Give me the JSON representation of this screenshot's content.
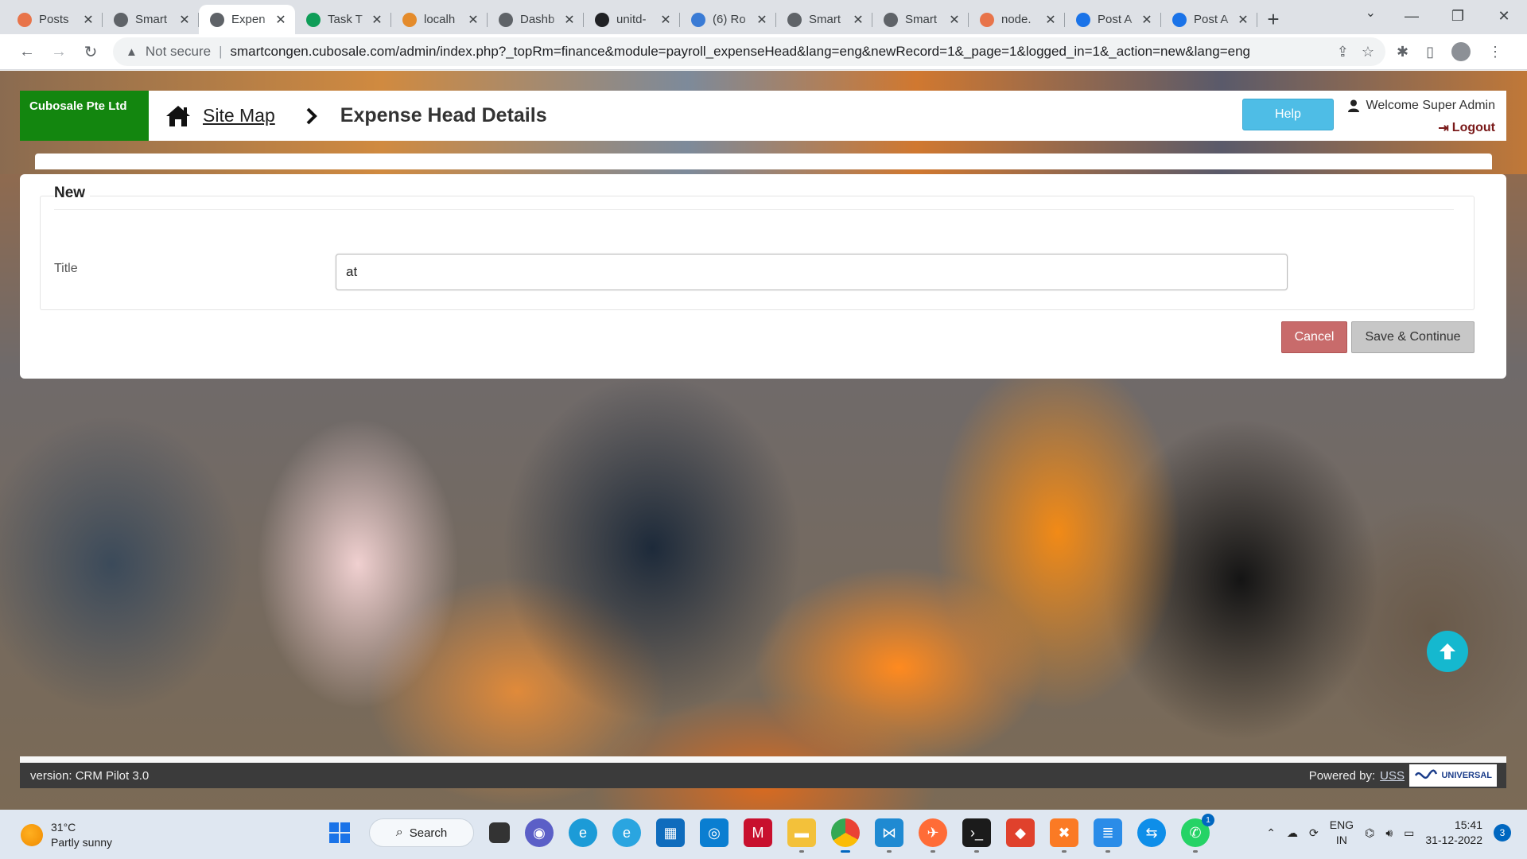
{
  "browser": {
    "tabs": [
      {
        "label": "Posts",
        "icon": "wordpress-icon",
        "color": "#e8744a"
      },
      {
        "label": "Smart",
        "icon": "globe-icon",
        "color": "#5f6368"
      },
      {
        "label": "Expen",
        "icon": "globe-icon",
        "color": "#5f6368",
        "active": true
      },
      {
        "label": "Task T",
        "icon": "sheets-icon",
        "color": "#0f9d58"
      },
      {
        "label": "localh",
        "icon": "phpmyadmin-icon",
        "color": "#e48b2b"
      },
      {
        "label": "Dashb",
        "icon": "globe-icon",
        "color": "#5f6368"
      },
      {
        "label": "unitd-",
        "icon": "github-icon",
        "color": "#202124"
      },
      {
        "label": "(6) Ro",
        "icon": "butterfly-icon",
        "color": "#3a7bd5"
      },
      {
        "label": "Smart",
        "icon": "globe-icon",
        "color": "#5f6368"
      },
      {
        "label": "Smart",
        "icon": "globe-icon",
        "color": "#5f6368"
      },
      {
        "label": "node.",
        "icon": "wordpress-icon",
        "color": "#e8744a"
      },
      {
        "label": "Post A",
        "icon": "zoho-icon",
        "color": "#1a73e8"
      },
      {
        "label": "Post A",
        "icon": "zoho-icon",
        "color": "#1a73e8"
      }
    ],
    "security": "Not secure",
    "url": "smartcongen.cubosale.com/admin/index.php?_topRm=finance&module=payroll_expenseHead&lang=eng&newRecord=1&_page=1&logged_in=1&_action=new&lang=eng"
  },
  "header": {
    "company": "Cubosale Pte Ltd",
    "sitemap": "Site Map",
    "title": "Expense Head Details",
    "help": "Help",
    "welcome": "Welcome Super Admin",
    "logout": "Logout"
  },
  "form": {
    "legend": "New",
    "title_label": "Title",
    "title_value": "at",
    "cancel": "Cancel",
    "save": "Save & Continue"
  },
  "footer": {
    "version": "version: CRM Pilot 3.0",
    "powered_by": "Powered by:",
    "uss": "USS",
    "logo_text": "UNIVERSAL"
  },
  "taskbar": {
    "temperature": "31°C",
    "weather": "Partly sunny",
    "search": "Search",
    "lang_primary": "ENG",
    "lang_secondary": "IN",
    "time": "15:41",
    "date": "31-12-2022",
    "notifications": "3",
    "whatsapp_badge": "1"
  },
  "colors": {
    "brand_green": "#13860f",
    "help_blue": "#4ebde6",
    "cancel_red": "#c86b6b",
    "scroll_top_teal": "#15b8cf"
  }
}
